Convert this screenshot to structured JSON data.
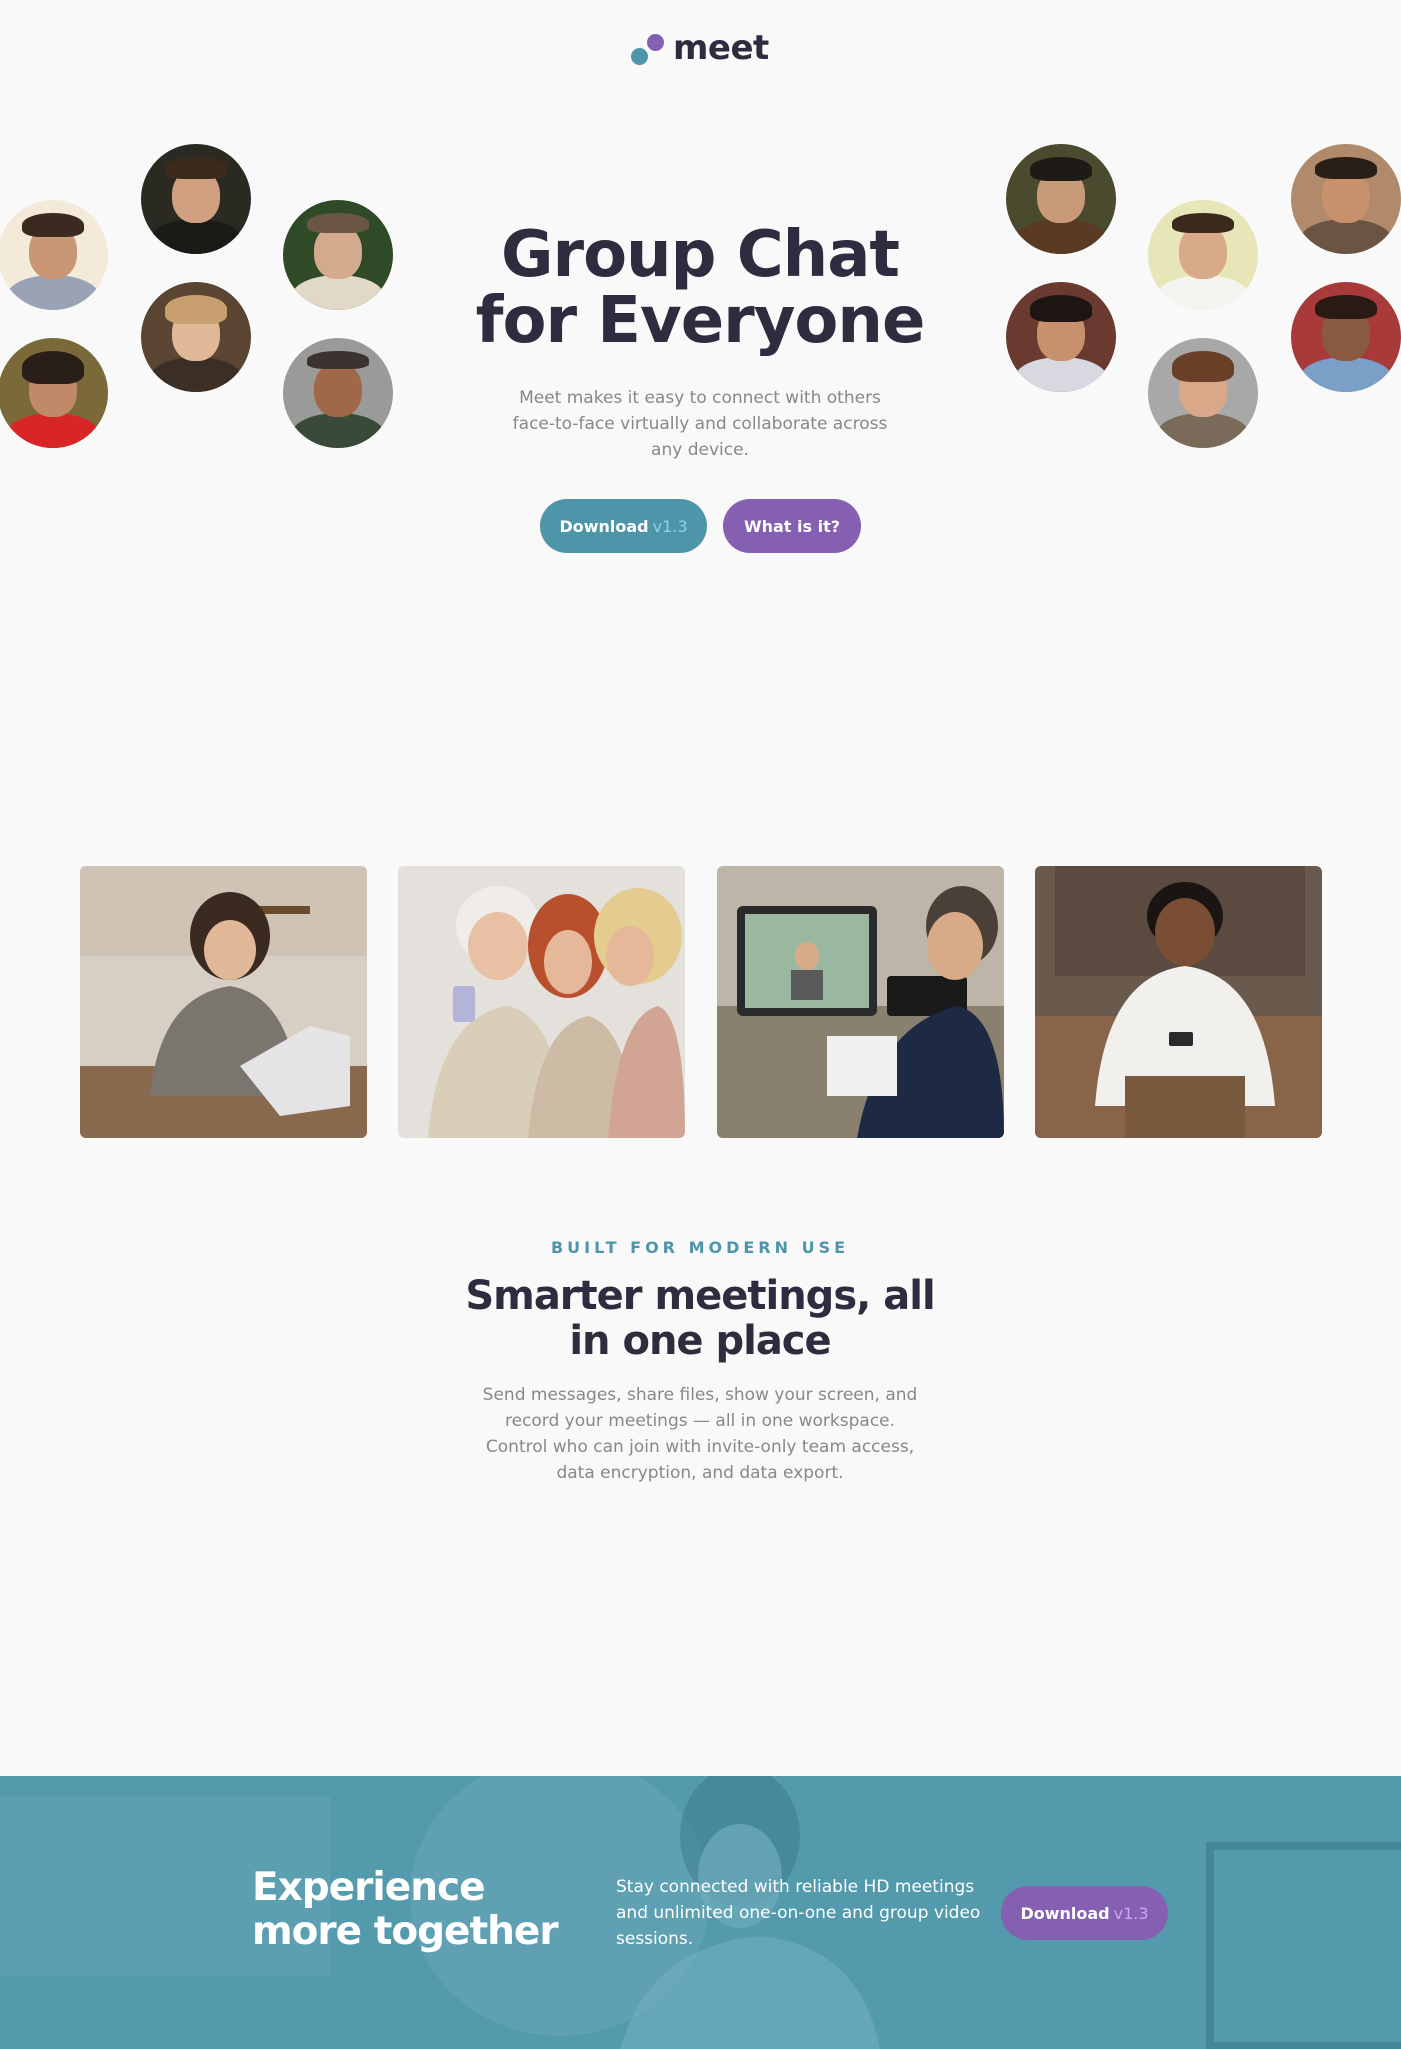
{
  "brand": {
    "name": "meet",
    "teal": "#4d96a9",
    "purple": "#855fb1",
    "dark": "#2d2d3f",
    "gray": "#87878d"
  },
  "hero": {
    "title_line1": "Group Chat",
    "title_line2": "for Everyone",
    "description": "Meet makes it easy to connect with others face-to-face virtually and collaborate across any device.",
    "download_label": "Download",
    "download_version": "v1.3",
    "what_label": "What is it?"
  },
  "features": {
    "eyebrow": "BUILT FOR MODERN USE",
    "title_line1": "Smarter meetings, all",
    "title_line2": "in one place",
    "description": "Send messages, share files, show your screen, and record your meetings — all in one workspace. Control who can join with invite-only team access, data encryption, and data export."
  },
  "cta": {
    "title_line1": "Experience",
    "title_line2": "more together",
    "description": "Stay connected with reliable HD meetings and unlimited one-on-one and group video sessions.",
    "download_label": "Download",
    "download_version": "v1.3"
  }
}
